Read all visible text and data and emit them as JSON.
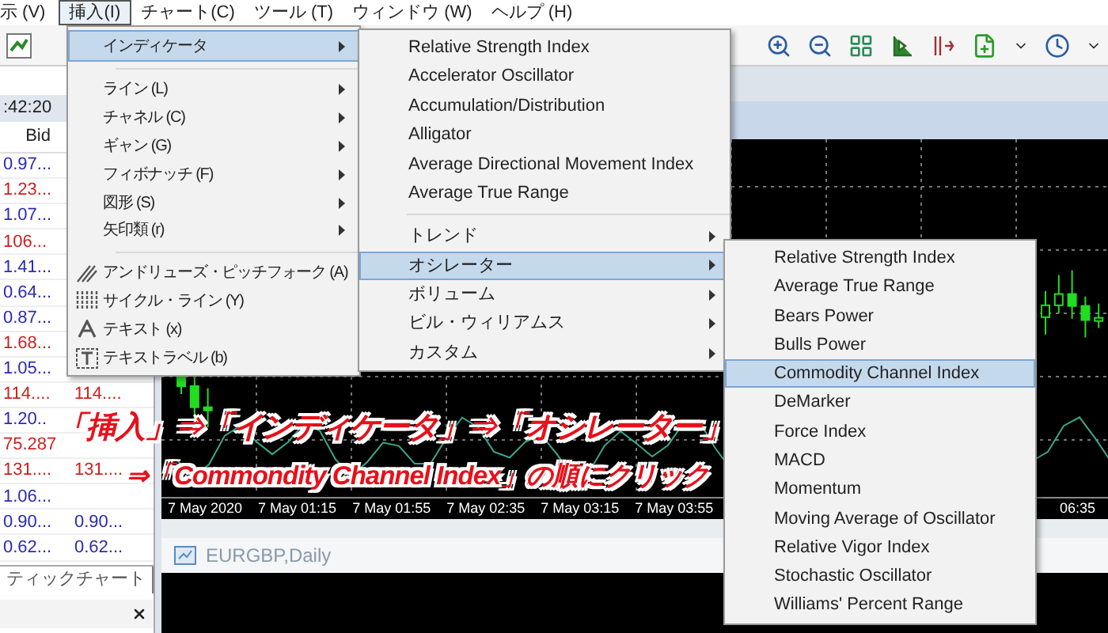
{
  "menubar": [
    {
      "label": "示 (V)",
      "selected": false
    },
    {
      "label": "挿入(I)",
      "selected": true
    },
    {
      "label": "チャート(C)",
      "selected": false
    },
    {
      "label": "ツール (T)",
      "selected": false
    },
    {
      "label": "ウィンドウ (W)",
      "selected": false
    },
    {
      "label": "ヘルプ (H)",
      "selected": false
    }
  ],
  "market_watch": {
    "time": ":42:20",
    "column": "Bid",
    "rows": [
      {
        "bid": "0.97...",
        "color": "#2b2bb5"
      },
      {
        "bid": "1.23...",
        "color": "#d02020"
      },
      {
        "bid": "1.07...",
        "color": "#2b2bb5"
      },
      {
        "bid": "106...",
        "color": "#d02020"
      },
      {
        "bid": "1.41...",
        "color": "#2b2bb5"
      },
      {
        "bid": "0.64...",
        "color": "#2b2bb5"
      },
      {
        "bid": "0.87...",
        "color": "#2b2bb5"
      },
      {
        "bid": "1.68...",
        "color": "#d02020"
      },
      {
        "bid": "1.05...",
        "color": "#2b2bb5"
      },
      {
        "bid": "114....",
        "ask": "114....",
        "color": "#d02020"
      },
      {
        "bid": "1.20..",
        "color": "#2b2bb5"
      },
      {
        "bid": "75.287",
        "color": "#d02020"
      },
      {
        "bid": "131....",
        "ask": "131....",
        "color": "#d02020"
      },
      {
        "bid": "1.06...",
        "color": "#2b2bb5"
      },
      {
        "bid": "0.90...",
        "ask": "0.90...",
        "color": "#2b2bb5"
      },
      {
        "bid": "0.62...",
        "ask": "0.62...",
        "color": "#2b2bb5"
      }
    ],
    "tab": "ティックチャート"
  },
  "chart": {
    "axis_labels": [
      "7 May 2020",
      "7 May 01:15",
      "7 May 01:55",
      "7 May 02:35",
      "7 May 03:15",
      "7 May 03:55"
    ],
    "axis_right": "06:35"
  },
  "second_window": {
    "title": "EURGBP,Daily"
  },
  "insert_menu": [
    {
      "kind": "submenu",
      "label": "インディケータ",
      "selected": true
    },
    {
      "kind": "separator"
    },
    {
      "kind": "submenu",
      "label": "ライン (L)",
      "selected": false
    },
    {
      "kind": "submenu",
      "label": "チャネル (C)",
      "selected": false
    },
    {
      "kind": "submenu",
      "label": "ギャン (G)",
      "selected": false
    },
    {
      "kind": "submenu",
      "label": "フィボナッチ (F)",
      "selected": false
    },
    {
      "kind": "submenu",
      "label": "図形 (S)",
      "selected": false
    },
    {
      "kind": "submenu",
      "label": "矢印類 (r)",
      "selected": false
    },
    {
      "kind": "separator"
    },
    {
      "kind": "tool",
      "label": "アンドリューズ・ピッチフォーク (A)",
      "selected": false
    },
    {
      "kind": "tool",
      "label": "サイクル・ライン (Y)",
      "selected": false
    },
    {
      "kind": "tool",
      "label": "テキスト (x)",
      "selected": false
    },
    {
      "kind": "tool",
      "label": "テキストラベル (b)",
      "selected": false
    }
  ],
  "indicator_menu": [
    {
      "kind": "item",
      "label": "Relative Strength Index",
      "selected": false
    },
    {
      "kind": "item",
      "label": "Accelerator Oscillator",
      "selected": false
    },
    {
      "kind": "item",
      "label": "Accumulation/Distribution",
      "selected": false
    },
    {
      "kind": "item",
      "label": "Alligator",
      "selected": false
    },
    {
      "kind": "item",
      "label": "Average Directional Movement Index",
      "selected": false
    },
    {
      "kind": "item",
      "label": "Average True Range",
      "selected": false
    },
    {
      "kind": "separator"
    },
    {
      "kind": "submenu",
      "label": "トレンド",
      "selected": false
    },
    {
      "kind": "submenu",
      "label": "オシレーター",
      "selected": true
    },
    {
      "kind": "submenu",
      "label": "ボリューム",
      "selected": false
    },
    {
      "kind": "submenu",
      "label": "ビル・ウィリアムス",
      "selected": false
    },
    {
      "kind": "submenu",
      "label": "カスタム",
      "selected": false
    }
  ],
  "oscillator_menu": [
    {
      "label": "Relative Strength Index",
      "selected": false
    },
    {
      "label": "Average True Range",
      "selected": false
    },
    {
      "label": "Bears Power",
      "selected": false
    },
    {
      "label": "Bulls Power",
      "selected": false
    },
    {
      "label": "Commodity Channel Index",
      "selected": true
    },
    {
      "label": "DeMarker",
      "selected": false
    },
    {
      "label": "Force Index",
      "selected": false
    },
    {
      "label": "MACD",
      "selected": false
    },
    {
      "label": "Momentum",
      "selected": false
    },
    {
      "label": "Moving Average of Oscillator",
      "selected": false
    },
    {
      "label": "Relative Vigor Index",
      "selected": false
    },
    {
      "label": "Stochastic Oscillator",
      "selected": false
    },
    {
      "label": "Williams' Percent Range",
      "selected": false
    }
  ],
  "annotation": [
    "「挿入」⇒「インディケータ」⇒「オシレーター」",
    "⇒「Commondity Channel Index」の順にクリック"
  ]
}
